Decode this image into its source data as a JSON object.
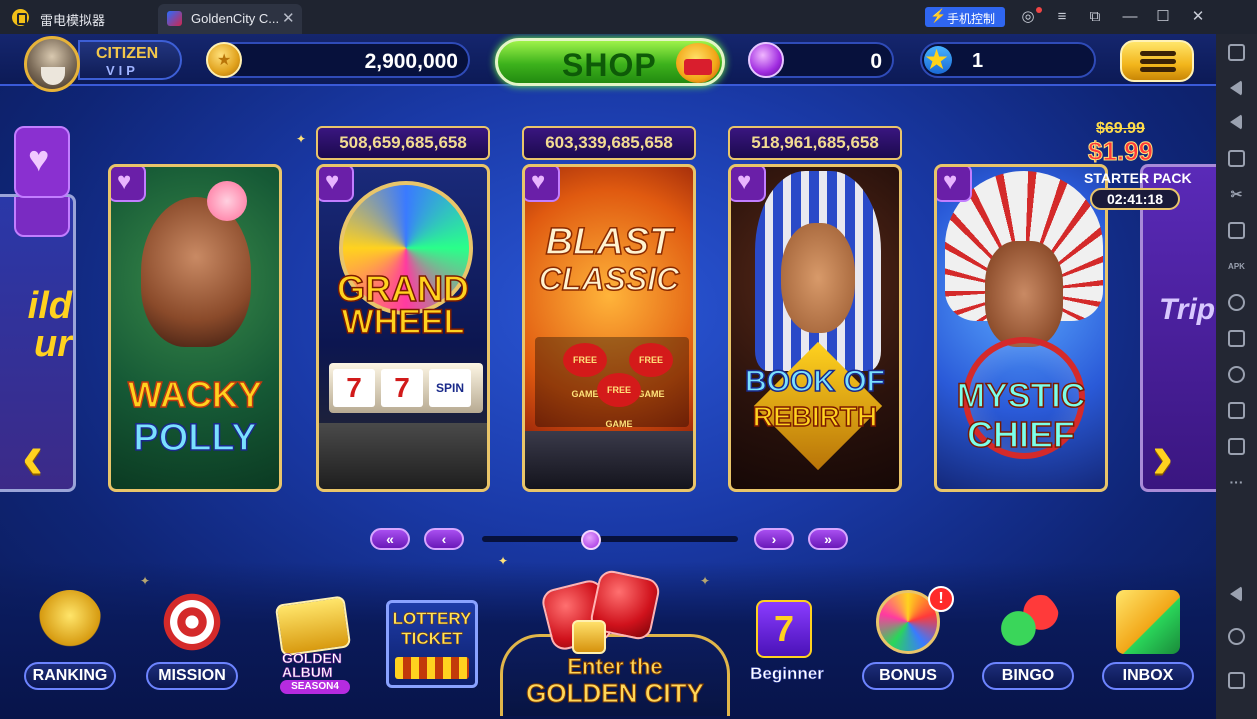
{
  "window": {
    "app_name": "雷电模拟器",
    "tab_title": "GoldenCity C...",
    "tab_close": "✕",
    "control_label": "手机控制",
    "buttons": {
      "account": "◎",
      "menu": "≡",
      "restore_float": "⧉",
      "minimize": "—",
      "maximize": "☐",
      "close": "✕"
    }
  },
  "sidebar": {
    "icons": [
      "keyboard-icon",
      "volume-up-icon",
      "volume-down-icon",
      "screenshot-icon",
      "scissors-icon",
      "add-icon",
      "apk-icon",
      "settings-icon",
      "folder-icon",
      "location-icon",
      "shake-icon",
      "sync-icon",
      "more-icon",
      "back-icon",
      "home-icon",
      "recent-apps-icon"
    ],
    "apk_label": "APK",
    "more_label": "···"
  },
  "header": {
    "rank_title": "CITIZEN",
    "rank_sub": "VIP",
    "coins": "2,900,000",
    "shop_label": "SHOP",
    "gems": "0",
    "stars": "1",
    "star_progress": 0.12,
    "colors": {
      "shop": "#3db21c",
      "coin": "#e0a11c",
      "gem": "#a02ce0",
      "menu": "#f2b51b"
    }
  },
  "games": [
    {
      "name": "WACKY POLLY",
      "line1": "WACKY",
      "line2": "POLLY",
      "jackpot": null
    },
    {
      "name": "GRAND WHEEL",
      "line1": "GRAND",
      "line2": "WHEEL",
      "jackpot": "508,659,685,658",
      "reel_symbol": "7",
      "spin_label": "SPIN"
    },
    {
      "name": "BLAST CLASSIC",
      "line1": "BLAST",
      "line2": "CLASSIC",
      "jackpot": "603,339,685,658",
      "free_label": "FREE GAME"
    },
    {
      "name": "BOOK OF REBIRTH",
      "line1": "BOOK OF",
      "line2": "REBIRTH",
      "jackpot": "518,961,685,658"
    },
    {
      "name": "MYSTIC CHIEF",
      "line1": "MYSTIC",
      "line2": "CHIEF",
      "jackpot": null
    }
  ],
  "partial_left_text": "ild\nur",
  "partial_right_text": "Trip",
  "starter_pack": {
    "old_price": "$69.99",
    "new_price": "$1.99",
    "label": "STARTER PACK",
    "timer": "02:41:18"
  },
  "pagination": {
    "first": "«",
    "prev": "‹",
    "next": "›",
    "last": "»",
    "position": 0.42
  },
  "arrows": {
    "left": "‹",
    "right": "›"
  },
  "nav": {
    "ranking": "RANKING",
    "mission": "MISSION",
    "album_1": "GOLDEN",
    "album_2": "ALBUM",
    "album_season": "SEASON4",
    "lottery_1": "LOTTERY",
    "lottery_2": "TICKET",
    "center_1": "Enter the",
    "center_2": "GOLDEN CITY",
    "beginner": "Beginner",
    "beginner_symbol": "7",
    "bonus": "BONUS",
    "bonus_badge": "!",
    "bingo": "BINGO",
    "inbox": "INBOX"
  }
}
